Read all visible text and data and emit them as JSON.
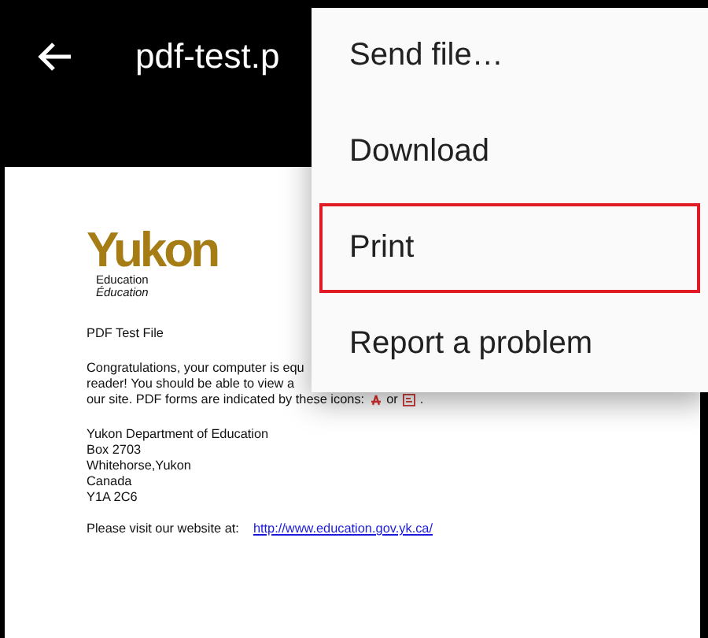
{
  "app_bar": {
    "title": "pdf-test.p"
  },
  "document": {
    "logo": {
      "wordmark": "Yukon",
      "subtitle": "Education",
      "subtitle_fr": "Éducation"
    },
    "heading": "PDF Test File",
    "intro_lines": [
      "Congratulations, your computer is equ",
      "reader!  You should be able to view a"
    ],
    "forms_line": {
      "text": "our site.  PDF forms are indicated by these icons:",
      "joiner": "or",
      "end": "."
    },
    "address": [
      "Yukon Department of Education",
      "Box 2703",
      "Whitehorse,Yukon",
      "Canada",
      "Y1A 2C6"
    ],
    "website": {
      "label": "Please visit our website at:",
      "link": "http://www.education.gov.yk.ca/"
    }
  },
  "menu": [
    {
      "label": "Send file…",
      "selected": false
    },
    {
      "label": "Download",
      "selected": false
    },
    {
      "label": "Print",
      "selected": true
    },
    {
      "label": "Report a problem",
      "selected": false
    }
  ]
}
